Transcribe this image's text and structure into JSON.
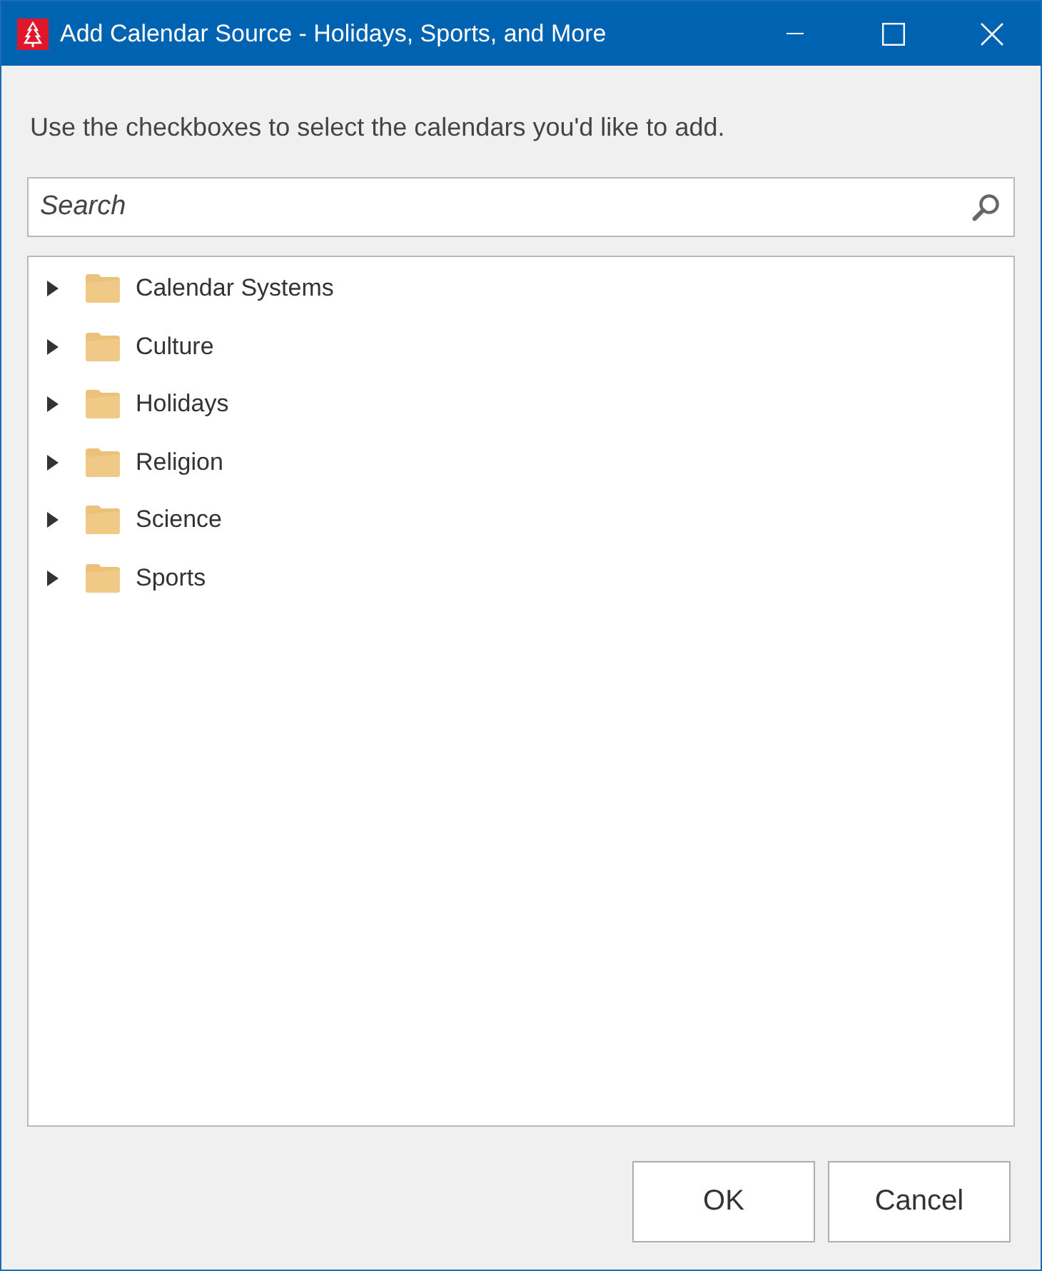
{
  "window": {
    "title": "Add Calendar Source - Holidays, Sports, and More"
  },
  "instruction": "Use the checkboxes to select the calendars you'd like to add.",
  "search": {
    "placeholder": "Search"
  },
  "tree": {
    "items": [
      {
        "label": "Calendar Systems",
        "expanded": false
      },
      {
        "label": "Culture",
        "expanded": false
      },
      {
        "label": "Holidays",
        "expanded": false
      },
      {
        "label": "Religion",
        "expanded": false
      },
      {
        "label": "Science",
        "expanded": false
      },
      {
        "label": "Sports",
        "expanded": false
      }
    ]
  },
  "buttons": [
    {
      "label": "OK"
    },
    {
      "label": "Cancel"
    }
  ]
}
